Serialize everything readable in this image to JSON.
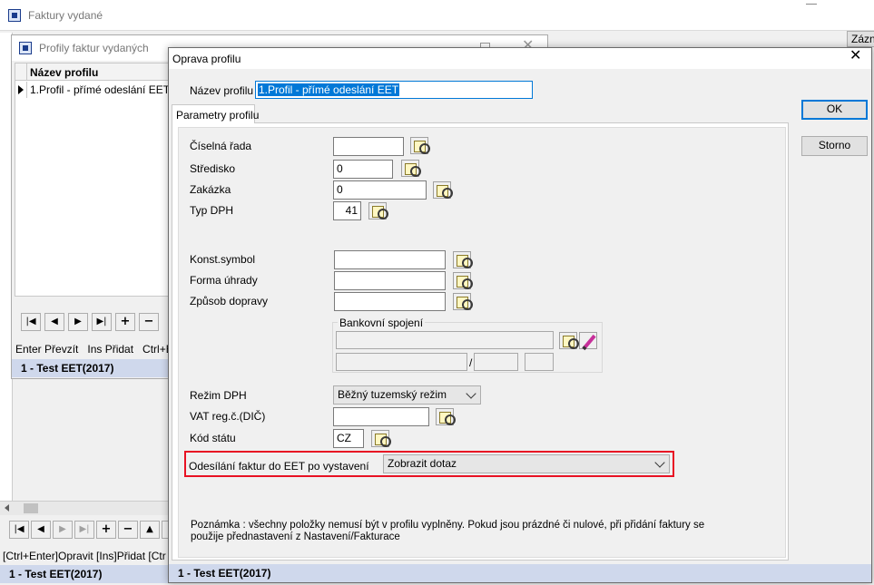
{
  "main_window": {
    "title": "Faktury vydané",
    "hint_bar": "[Ctrl+Enter]Opravit [Ins]Přidat [Ctr",
    "status": "1 - Test EET(2017)",
    "right_btn_label": "Zázn"
  },
  "profiles_window": {
    "title": "Profily faktur vydaných",
    "column_header": "Název profilu",
    "rows": [
      "1.Profil - přímé odeslání EET"
    ],
    "hint": "Enter Převzít   Ins Přidat   Ctrl+En",
    "status": "1 - Test EET(2017)"
  },
  "dialog": {
    "title": "Oprava profilu",
    "name_label": "Název profilu",
    "name_value": "1.Profil - přímé odeslání EET",
    "tab_label": "Parametry profilu",
    "ok_label": "OK",
    "cancel_label": "Storno",
    "fields": {
      "ciselna_rada": {
        "label": "Číselná řada",
        "value": ""
      },
      "stredisko": {
        "label": "Středisko",
        "value": "0"
      },
      "zakazka": {
        "label": "Zakázka",
        "value": "0"
      },
      "typ_dph": {
        "label": "Typ DPH",
        "value": "41"
      },
      "konst_symbol": {
        "label": "Konst.symbol",
        "value": ""
      },
      "forma_uhrady": {
        "label": "Forma úhrady",
        "value": ""
      },
      "zpusob_dopravy": {
        "label": "Způsob dopravy",
        "value": ""
      },
      "rezim_dph": {
        "label": "Režim DPH",
        "value": "Běžný tuzemský režim"
      },
      "vat_reg": {
        "label": "VAT reg.č.(DIČ)",
        "value": ""
      },
      "kod_statu": {
        "label": "Kód státu",
        "value": "CZ"
      },
      "eet": {
        "label": "Odesílání faktur do EET po vystavení",
        "value": "Zobrazit dotaz"
      }
    },
    "bank_group_label": "Bankovní spojení",
    "bank_separator": "/",
    "note_line1": "Poznámka : všechny položky nemusí být v profilu vyplněny. Pokud jsou prázdné či nulové, při přidání faktury se",
    "note_line2": "použije přednastavení z Nastavení/Fakturace",
    "status": "1 - Test EET(2017)",
    "highlight_color": "#e81123"
  }
}
